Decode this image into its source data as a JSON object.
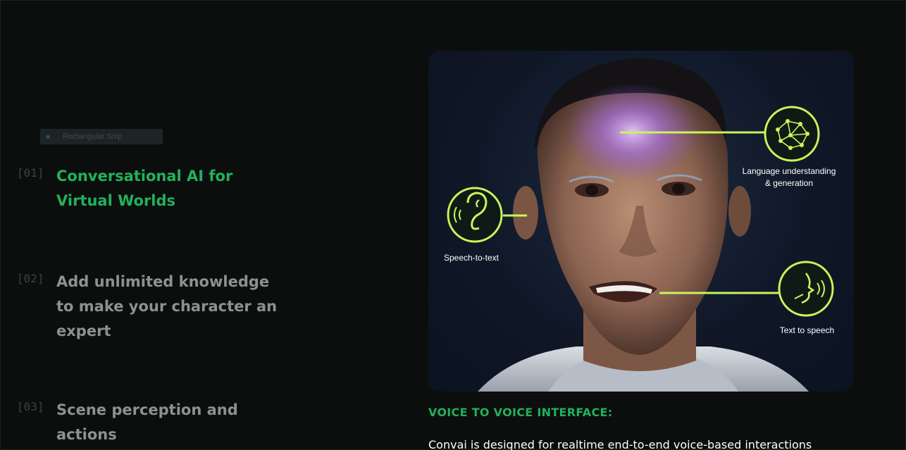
{
  "snip_tooltip": {
    "icon": "scissors-icon",
    "label": "Rectangular Snip"
  },
  "features": [
    {
      "number": "[01]",
      "title": "Conversational AI for Virtual Worlds",
      "active": true
    },
    {
      "number": "[02]",
      "title": "Add unlimited knowledge to make your character an expert",
      "active": false
    },
    {
      "number": "[03]",
      "title": "Scene perception and actions",
      "active": false
    }
  ],
  "hero": {
    "callouts": {
      "language": {
        "label_line1": "Language understanding",
        "label_line2": "& generation",
        "icon": "neural-network-icon"
      },
      "speech_to_text": {
        "label": "Speech-to-text",
        "icon": "ear-icon"
      },
      "text_to_speech": {
        "label": "Text to speech",
        "icon": "speaking-head-icon"
      }
    }
  },
  "section": {
    "heading": "VOICE TO VOICE INTERFACE:",
    "body": "Convai is designed for realtime end-to-end voice-based interactions"
  },
  "colors": {
    "accent_green": "#20b25c",
    "callout_lime": "#c8f55a",
    "background": "#0b0e0d",
    "muted_text": "#8d918f"
  }
}
